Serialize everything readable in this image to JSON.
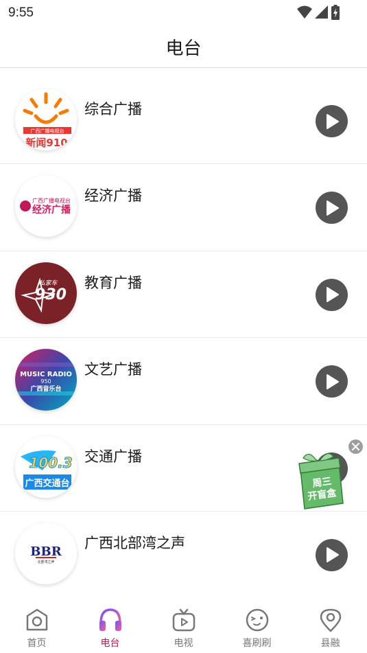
{
  "status_bar": {
    "time": "9:55"
  },
  "header": {
    "title": "电台"
  },
  "stations": [
    {
      "name": "综合广播",
      "logo_text": "新闻910",
      "logo_sub": "广西广播电视台"
    },
    {
      "name": "经济广播",
      "logo_text": "经济广播",
      "logo_sub": "广西广播电视台"
    },
    {
      "name": "教育广播",
      "logo_text": "930",
      "logo_sub": "私家车"
    },
    {
      "name": "文艺广播",
      "logo_text": "MUSIC RADIO",
      "logo_sub": "广西音乐台",
      "logo_freq": "950"
    },
    {
      "name": "交通广播",
      "logo_text": "100.3",
      "logo_sub": "广西交通台"
    },
    {
      "name": "广西北部湾之声",
      "logo_text": "BBR",
      "logo_sub": "北部湾之声"
    }
  ],
  "promo": {
    "text": "周三开盲盒"
  },
  "bottom_nav": [
    {
      "label": "首页"
    },
    {
      "label": "电台"
    },
    {
      "label": "电视"
    },
    {
      "label": "喜刷刷"
    },
    {
      "label": "县融"
    }
  ],
  "colors": {
    "accent": "#c2185b",
    "play": "#555555",
    "divider": "#ececec"
  }
}
